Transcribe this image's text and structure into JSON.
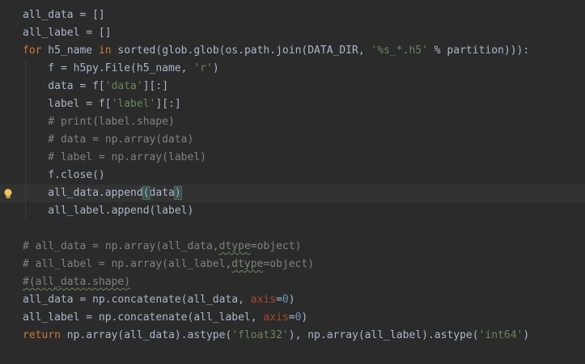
{
  "editor": {
    "colors": {
      "background": "#2b2b2b",
      "current_line": "#323232",
      "keyword": "#cc7832",
      "string": "#6a8759",
      "comment": "#808080",
      "number": "#6897bb",
      "named_argument": "#aa4926",
      "text": "#a9b7c6",
      "intention_bulb": "#f2c55c"
    },
    "gutter_icon": "lightbulb-icon",
    "lines": [
      {
        "segments": [
          {
            "t": "all_data = []",
            "c": "plain"
          }
        ]
      },
      {
        "segments": [
          {
            "t": "all_label = []",
            "c": "plain"
          }
        ]
      },
      {
        "segments": [
          {
            "t": "for",
            "c": "kw"
          },
          {
            "t": " h5_name ",
            "c": "plain"
          },
          {
            "t": "in",
            "c": "kw"
          },
          {
            "t": " sorted(glob.glob(os.path.join(DATA_DIR, ",
            "c": "plain"
          },
          {
            "t": "'%s_*.h5'",
            "c": "str"
          },
          {
            "t": " % partition))):",
            "c": "plain"
          }
        ]
      },
      {
        "segments": [
          {
            "t": "    f = h5py.File(h5_name, ",
            "c": "plain"
          },
          {
            "t": "'r'",
            "c": "str"
          },
          {
            "t": ")",
            "c": "plain"
          }
        ]
      },
      {
        "segments": [
          {
            "t": "    data = f[",
            "c": "plain"
          },
          {
            "t": "'data'",
            "c": "str"
          },
          {
            "t": "][:]",
            "c": "plain"
          }
        ]
      },
      {
        "segments": [
          {
            "t": "    label = f[",
            "c": "plain"
          },
          {
            "t": "'label'",
            "c": "str"
          },
          {
            "t": "][:]",
            "c": "plain"
          }
        ]
      },
      {
        "segments": [
          {
            "t": "    # print(label.shape)",
            "c": "cm"
          }
        ]
      },
      {
        "segments": [
          {
            "t": "    # data = np.array(data)",
            "c": "cm"
          }
        ]
      },
      {
        "segments": [
          {
            "t": "    # label = np.array(label)",
            "c": "cm"
          }
        ]
      },
      {
        "segments": [
          {
            "t": "    f.close()",
            "c": "plain"
          }
        ]
      },
      {
        "current": true,
        "bulb": true,
        "segments": [
          {
            "t": "    all_data.append",
            "c": "plain"
          },
          {
            "t": "(",
            "c": "plain brace-match"
          },
          {
            "t": "data",
            "c": "plain"
          },
          {
            "t": ")",
            "c": "plain brace-match"
          }
        ]
      },
      {
        "segments": [
          {
            "t": "    all_label.append(label)",
            "c": "plain"
          }
        ]
      },
      {
        "segments": []
      },
      {
        "segments": [
          {
            "t": "# all_data = np.array(all_data,",
            "c": "cm"
          },
          {
            "t": "dtype",
            "c": "cm wavy"
          },
          {
            "t": "=object)",
            "c": "cm"
          }
        ]
      },
      {
        "segments": [
          {
            "t": "# all_label = np.array(all_label,",
            "c": "cm"
          },
          {
            "t": "dtype",
            "c": "cm wavy"
          },
          {
            "t": "=object)",
            "c": "cm"
          }
        ]
      },
      {
        "segments": [
          {
            "t": "#(all_data.shape)",
            "c": "cm wavy-cm"
          }
        ]
      },
      {
        "segments": [
          {
            "t": "all_data = np.concatenate(all_data, ",
            "c": "plain"
          },
          {
            "t": "axis",
            "c": "param"
          },
          {
            "t": "=",
            "c": "plain"
          },
          {
            "t": "0",
            "c": "num"
          },
          {
            "t": ")",
            "c": "plain"
          }
        ]
      },
      {
        "segments": [
          {
            "t": "all_label = np.concatenate(all_label, ",
            "c": "plain"
          },
          {
            "t": "axis",
            "c": "param"
          },
          {
            "t": "=",
            "c": "plain"
          },
          {
            "t": "0",
            "c": "num"
          },
          {
            "t": ")",
            "c": "plain"
          }
        ]
      },
      {
        "segments": [
          {
            "t": "return",
            "c": "kw"
          },
          {
            "t": " np.array(all_data).astype(",
            "c": "plain"
          },
          {
            "t": "'float32'",
            "c": "str"
          },
          {
            "t": "), np.array(all_label).astype(",
            "c": "plain"
          },
          {
            "t": "'int64'",
            "c": "str"
          },
          {
            "t": ")",
            "c": "plain"
          }
        ]
      }
    ]
  }
}
